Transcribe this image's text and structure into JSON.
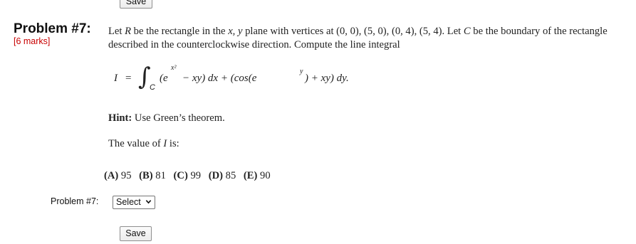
{
  "top_save_label": "Save",
  "problem": {
    "title": "Problem #7:",
    "marks": "[6 marks]",
    "statement": [
      {
        "t": "Let ",
        "m": false
      },
      {
        "t": "R",
        "m": true
      },
      {
        "t": " be the rectangle in the ",
        "m": false
      },
      {
        "t": "x, y",
        "m": true
      },
      {
        "t": " plane with vertices at (0, 0), (5, 0), (0, 4), (5, 4). Let ",
        "m": false
      },
      {
        "t": "C",
        "m": true
      },
      {
        "t": " be the boundary of the rectangle described in the counterclockwise direction. Compute the line integral",
        "m": false
      }
    ],
    "formula": {
      "lhs": "I",
      "eq": "=",
      "integral_sign": "∫",
      "sub": "C",
      "part1_open": "(e",
      "exp1": "x²",
      "part1_rest": " − xy) dx + (cos(e",
      "exp2": "y",
      "part2_rest": ") + xy) dy."
    },
    "hint_bold": "Hint:",
    "hint_text": " Use Green’s theorem.",
    "value_prefix": "The value of ",
    "value_var": "I",
    "value_suffix": " is:",
    "options": [
      {
        "key": "(A)",
        "val": "95"
      },
      {
        "key": "(B)",
        "val": "81"
      },
      {
        "key": "(C)",
        "val": "99"
      },
      {
        "key": "(D)",
        "val": "85"
      },
      {
        "key": "(E)",
        "val": "90"
      }
    ]
  },
  "answer": {
    "label": "Problem #7:",
    "select_value": "Select",
    "chevron_icon": "chevron-down-icon"
  },
  "bottom_save_label": "Save"
}
